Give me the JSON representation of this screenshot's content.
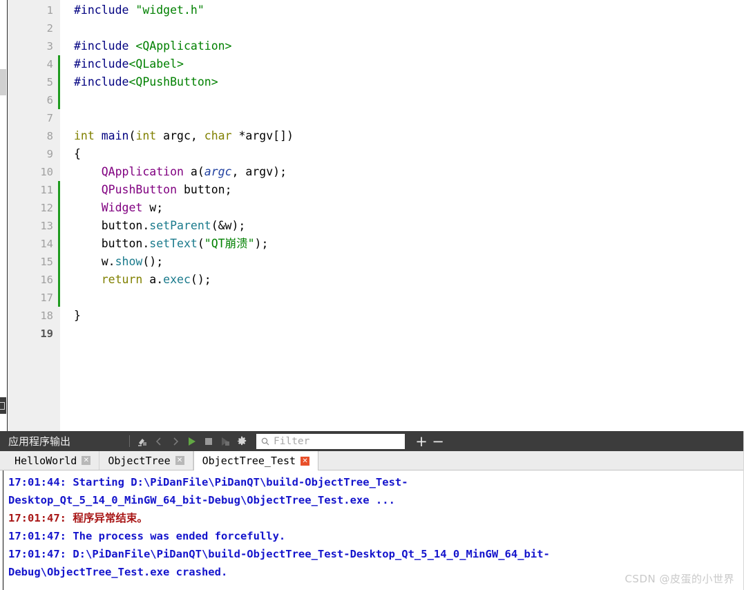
{
  "editor": {
    "line_numbers": [
      "1",
      "2",
      "3",
      "4",
      "5",
      "6",
      "7",
      "8",
      "9",
      "10",
      "11",
      "12",
      "13",
      "14",
      "15",
      "16",
      "17",
      "18",
      "19"
    ],
    "current_line": "19",
    "fold_marker_line": "8",
    "fold_marker_glyph": "▼",
    "change_marker_ranges": [
      [
        4,
        6
      ],
      [
        11,
        17
      ]
    ],
    "lines": [
      {
        "n": 1,
        "tokens": [
          {
            "t": "#include",
            "c": "pre"
          },
          {
            "t": " ",
            "c": "plain"
          },
          {
            "t": "\"widget.h\"",
            "c": "str"
          }
        ]
      },
      {
        "n": 2,
        "tokens": []
      },
      {
        "n": 3,
        "tokens": [
          {
            "t": "#include",
            "c": "pre"
          },
          {
            "t": " ",
            "c": "plain"
          },
          {
            "t": "<QApplication>",
            "c": "str"
          }
        ]
      },
      {
        "n": 4,
        "tokens": [
          {
            "t": "#include",
            "c": "pre"
          },
          {
            "t": "<QLabel>",
            "c": "str"
          }
        ]
      },
      {
        "n": 5,
        "tokens": [
          {
            "t": "#include",
            "c": "pre"
          },
          {
            "t": "<QPushButton>",
            "c": "str"
          }
        ]
      },
      {
        "n": 6,
        "tokens": []
      },
      {
        "n": 7,
        "tokens": []
      },
      {
        "n": 8,
        "tokens": [
          {
            "t": "int",
            "c": "kw"
          },
          {
            "t": " ",
            "c": "plain"
          },
          {
            "t": "main",
            "c": "fn"
          },
          {
            "t": "(",
            "c": "plain"
          },
          {
            "t": "int",
            "c": "kw"
          },
          {
            "t": " argc, ",
            "c": "plain"
          },
          {
            "t": "char",
            "c": "kw"
          },
          {
            "t": " *argv[])",
            "c": "plain"
          }
        ]
      },
      {
        "n": 9,
        "tokens": [
          {
            "t": "{",
            "c": "plain"
          }
        ]
      },
      {
        "n": 10,
        "tokens": [
          {
            "t": "    ",
            "c": "plain"
          },
          {
            "t": "QApplication",
            "c": "cls"
          },
          {
            "t": " a(",
            "c": "plain"
          },
          {
            "t": "argc",
            "c": "param"
          },
          {
            "t": ", argv);",
            "c": "plain"
          }
        ]
      },
      {
        "n": 11,
        "tokens": [
          {
            "t": "    ",
            "c": "plain"
          },
          {
            "t": "QPushButton",
            "c": "cls"
          },
          {
            "t": " button;",
            "c": "plain"
          }
        ]
      },
      {
        "n": 12,
        "tokens": [
          {
            "t": "    ",
            "c": "plain"
          },
          {
            "t": "Widget",
            "c": "cls"
          },
          {
            "t": " w;",
            "c": "plain"
          }
        ]
      },
      {
        "n": 13,
        "tokens": [
          {
            "t": "    button.",
            "c": "plain"
          },
          {
            "t": "setParent",
            "c": "meth"
          },
          {
            "t": "(&w);",
            "c": "plain"
          }
        ]
      },
      {
        "n": 14,
        "tokens": [
          {
            "t": "    button.",
            "c": "plain"
          },
          {
            "t": "setText",
            "c": "meth"
          },
          {
            "t": "(",
            "c": "plain"
          },
          {
            "t": "\"QT崩溃\"",
            "c": "str"
          },
          {
            "t": ");",
            "c": "plain"
          }
        ]
      },
      {
        "n": 15,
        "tokens": [
          {
            "t": "    w.",
            "c": "plain"
          },
          {
            "t": "show",
            "c": "meth"
          },
          {
            "t": "();",
            "c": "plain"
          }
        ]
      },
      {
        "n": 16,
        "tokens": [
          {
            "t": "    ",
            "c": "plain"
          },
          {
            "t": "return",
            "c": "kw"
          },
          {
            "t": " a.",
            "c": "plain"
          },
          {
            "t": "exec",
            "c": "meth"
          },
          {
            "t": "();",
            "c": "plain"
          }
        ]
      },
      {
        "n": 17,
        "tokens": []
      },
      {
        "n": 18,
        "tokens": [
          {
            "t": "}",
            "c": "plain"
          }
        ]
      },
      {
        "n": 19,
        "tokens": []
      }
    ]
  },
  "output": {
    "title": "应用程序输出",
    "toolbar_icons": [
      {
        "name": "clear-output-icon",
        "label": "清除"
      },
      {
        "name": "prev-item-icon",
        "label": "上一项"
      },
      {
        "name": "next-item-icon",
        "label": "下一项"
      },
      {
        "name": "run-icon",
        "label": "运行"
      },
      {
        "name": "stop-icon",
        "label": "停止"
      },
      {
        "name": "attach-debugger-icon",
        "label": "附加调试器"
      },
      {
        "name": "settings-gear-icon",
        "label": "设置"
      }
    ],
    "filter": {
      "placeholder": "Filter",
      "value": ""
    },
    "zoom_in_label": "+",
    "zoom_out_label": "−",
    "tabs": [
      {
        "label": "HelloWorld",
        "active": false,
        "close": "✕"
      },
      {
        "label": "ObjectTree",
        "active": false,
        "close": "✕"
      },
      {
        "label": "ObjectTree_Test",
        "active": true,
        "close": "✕"
      }
    ],
    "console_lines": [
      {
        "id": "l1",
        "color": "blue",
        "text": "17:01:44: Starting D:\\PiDanFile\\PiDanQT\\build-ObjectTree_Test-"
      },
      {
        "id": "l2",
        "color": "blue",
        "text": "Desktop_Qt_5_14_0_MinGW_64_bit-Debug\\ObjectTree_Test.exe ..."
      },
      {
        "id": "l3",
        "color": "red",
        "text": "17:01:47: 程序异常结束。"
      },
      {
        "id": "l4",
        "color": "blue",
        "text": "17:01:47: The process was ended forcefully."
      },
      {
        "id": "l5",
        "color": "blue",
        "text": "17:01:47: D:\\PiDanFile\\PiDanQT\\build-ObjectTree_Test-Desktop_Qt_5_14_0_MinGW_64_bit-"
      },
      {
        "id": "l6",
        "color": "blue",
        "text": "Debug\\ObjectTree_Test.exe crashed."
      }
    ]
  },
  "watermark": {
    "text": "CSDN @皮蛋的小世界"
  },
  "colors": {
    "toolbar_bg": "#3c3c3c",
    "gutter_bg": "#efefef",
    "change_marker": "#1f9b1f",
    "console_blue": "#1414cc",
    "console_red": "#a81616",
    "active_tab_close": "#e8502a",
    "run_green": "#62a844"
  }
}
